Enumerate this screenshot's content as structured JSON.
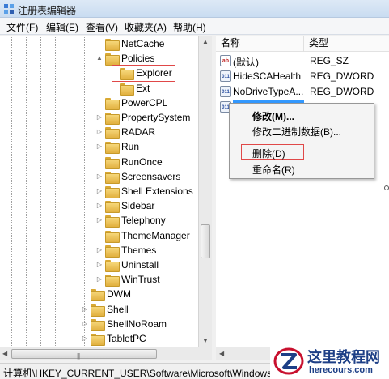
{
  "window": {
    "title": "注册表编辑器"
  },
  "menu": [
    "文件(F)",
    "编辑(E)",
    "查看(V)",
    "收藏夹(A)",
    "帮助(H)"
  ],
  "tree": [
    {
      "label": "NetCache",
      "depth": 1,
      "expander": ""
    },
    {
      "label": "Policies",
      "depth": 1,
      "expander": "▲"
    },
    {
      "label": "Explorer",
      "depth": 2,
      "expander": "",
      "selected": true
    },
    {
      "label": "Ext",
      "depth": 2,
      "expander": ""
    },
    {
      "label": "PowerCPL",
      "depth": 1,
      "expander": ""
    },
    {
      "label": "PropertySystem",
      "depth": 1,
      "expander": "▷"
    },
    {
      "label": "RADAR",
      "depth": 1,
      "expander": "▷"
    },
    {
      "label": "Run",
      "depth": 1,
      "expander": "▷"
    },
    {
      "label": "RunOnce",
      "depth": 1,
      "expander": ""
    },
    {
      "label": "Screensavers",
      "depth": 1,
      "expander": "▷"
    },
    {
      "label": "Shell Extensions",
      "depth": 1,
      "expander": "▷"
    },
    {
      "label": "Sidebar",
      "depth": 1,
      "expander": "▷"
    },
    {
      "label": "Telephony",
      "depth": 1,
      "expander": "▷"
    },
    {
      "label": "ThemeManager",
      "depth": 1,
      "expander": ""
    },
    {
      "label": "Themes",
      "depth": 1,
      "expander": "▷"
    },
    {
      "label": "Uninstall",
      "depth": 1,
      "expander": "▷"
    },
    {
      "label": "WinTrust",
      "depth": 1,
      "expander": "▷"
    },
    {
      "label": "DWM",
      "depth": 0,
      "expander": ""
    },
    {
      "label": "Shell",
      "depth": 0,
      "expander": "▷"
    },
    {
      "label": "ShellNoRoam",
      "depth": 0,
      "expander": "▷"
    },
    {
      "label": "TabletPC",
      "depth": 0,
      "expander": "▷"
    }
  ],
  "values": {
    "headers": {
      "name": "名称",
      "type": "类型"
    },
    "rows": [
      {
        "name": "(默认)",
        "type": "REG_SZ",
        "icon": "ab"
      },
      {
        "name": "HideSCAHealth",
        "type": "REG_DWORD",
        "icon": "bin"
      },
      {
        "name": "NoDriveTypeA...",
        "type": "REG_DWORD",
        "icon": "bin"
      },
      {
        "name": "",
        "type": "",
        "icon": "bin",
        "highlighted": true
      }
    ]
  },
  "context_menu": {
    "modify": "修改(M)...",
    "modify_binary": "修改二进制数据(B)...",
    "delete": "删除(D)",
    "rename": "重命名(R)"
  },
  "status": {
    "path": "计算机\\HKEY_CURRENT_USER\\Software\\Microsoft\\Windows\\Cu"
  },
  "watermark": {
    "name": "这里教程网",
    "url": "herecours.com"
  },
  "colors": {
    "title_bar": "#c9dcf1",
    "selection": "#3399ff",
    "annotation_red": "#e04848",
    "brand_blue": "#1d3f86"
  }
}
